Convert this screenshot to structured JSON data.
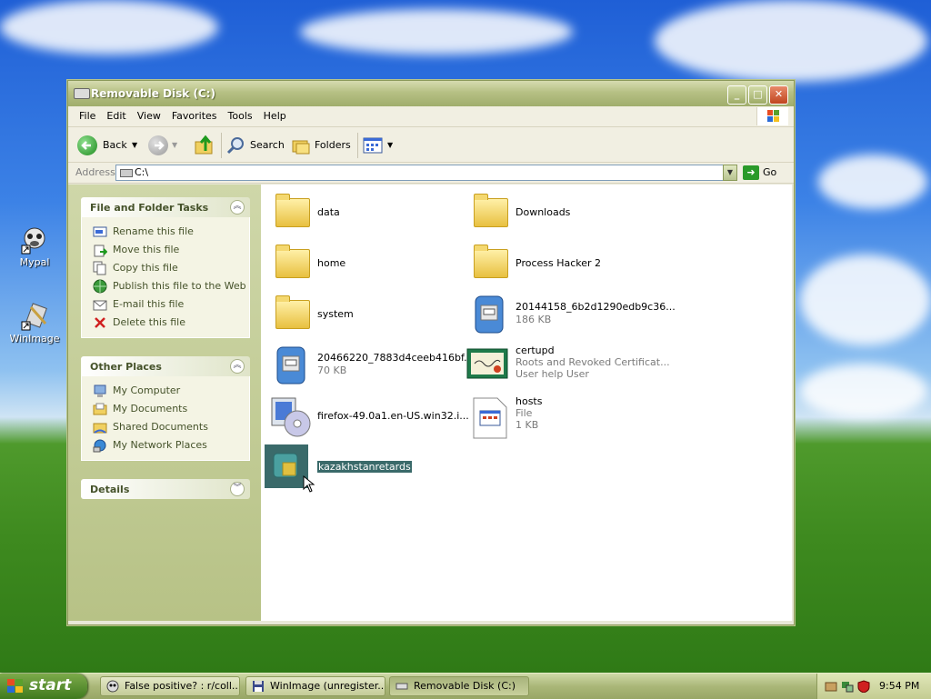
{
  "desktop": {
    "icons": [
      {
        "label": "Mypal"
      },
      {
        "label": "WinImage"
      }
    ]
  },
  "window": {
    "title": "Removable Disk (C:)",
    "controls": {
      "minimize": "_",
      "maximize": "□",
      "close": "✕"
    },
    "menu": [
      "File",
      "Edit",
      "View",
      "Favorites",
      "Tools",
      "Help"
    ],
    "toolbar": {
      "back": "Back",
      "search": "Search",
      "folders": "Folders"
    },
    "address": {
      "label": "Address",
      "value": "C:\\",
      "go": "Go"
    },
    "tasks_panel": {
      "title": "File and Folder Tasks",
      "items": [
        "Rename this file",
        "Move this file",
        "Copy this file",
        "Publish this file to the Web",
        "E-mail this file",
        "Delete this file"
      ]
    },
    "places_panel": {
      "title": "Other Places",
      "items": [
        "My Computer",
        "My Documents",
        "Shared Documents",
        "My Network Places"
      ]
    },
    "details_panel": {
      "title": "Details"
    },
    "files": [
      {
        "name": "data",
        "type": "folder"
      },
      {
        "name": "Downloads",
        "type": "folder"
      },
      {
        "name": "home",
        "type": "folder"
      },
      {
        "name": "Process Hacker 2",
        "type": "folder"
      },
      {
        "name": "system",
        "type": "folder"
      },
      {
        "name": "20144158_6b2d1290edb9c36...",
        "line2": "186 KB",
        "type": "installer"
      },
      {
        "name": "20466220_7883d4ceeb416bf...",
        "line2": "70 KB",
        "type": "installer"
      },
      {
        "name": "certupd",
        "line2": "Roots and Revoked Certificat...",
        "line3": "User help User",
        "type": "certificate"
      },
      {
        "name": "firefox-49.0a1.en-US.win32.i...",
        "type": "setup"
      },
      {
        "name": "hosts",
        "line2": "File",
        "line3": "1 KB",
        "type": "file"
      },
      {
        "name": "kazakhstanretards",
        "type": "selected-app"
      }
    ]
  },
  "taskbar": {
    "start": "start",
    "tasks": [
      {
        "label": "False positive? : r/coll..."
      },
      {
        "label": "WinImage (unregister..."
      },
      {
        "label": "Removable Disk (C:)"
      }
    ],
    "clock": "9:54 PM"
  },
  "colors": {
    "xp_olive_title": "#a0ad6c",
    "selection": "#3a6a6a",
    "sidebar_text": "#45522a"
  }
}
